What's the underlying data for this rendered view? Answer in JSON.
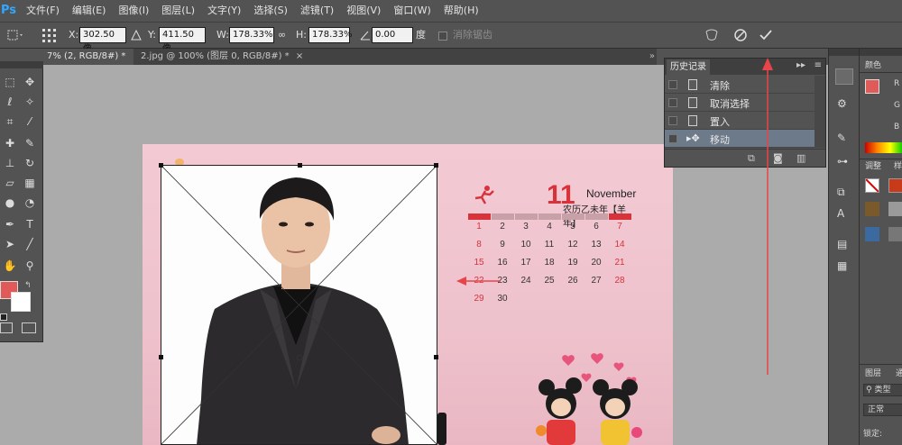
{
  "app": {
    "logo": "Ps",
    "menu": [
      "文件(F)",
      "编辑(E)",
      "图像(I)",
      "图层(L)",
      "文字(Y)",
      "选择(S)",
      "滤镜(T)",
      "视图(V)",
      "窗口(W)",
      "帮助(H)"
    ]
  },
  "options": {
    "x_label": "X:",
    "x_value": "302.50 像",
    "y_label": "Y:",
    "y_value": "411.50 像",
    "w_label": "W:",
    "w_value": "178.33%",
    "h_label": "H:",
    "h_value": "178.33%",
    "angle_value": "0.00",
    "angle_unit": "度",
    "antialias_label": "消除锯齿"
  },
  "tabs": [
    {
      "label": "7% (2, RGB/8#) *",
      "close": "×"
    },
    {
      "label": "2.jpg @ 100% (图层 0, RGB/8#) *",
      "close": "×"
    }
  ],
  "history": {
    "title": "历史记录",
    "items": [
      "清除",
      "取消选择",
      "置入",
      "移动"
    ],
    "active_index": 3
  },
  "right_panels": {
    "color_tab": "颜色",
    "color_r": "R",
    "color_g": "G",
    "color_b": "B",
    "adjust_tab": "调整",
    "style_tab": "样",
    "layers_tab": "图层",
    "channels_tab": "通",
    "layer_filter": "类型",
    "blend_mode": "正常",
    "lock_label": "锁定:"
  },
  "calendar": {
    "day": "11",
    "month_en": "November",
    "lunar": "农历乙未年【羊年】",
    "weeks": [
      [
        "",
        "1",
        "2",
        "3",
        "4",
        "5",
        "6",
        "7"
      ],
      [
        "",
        "8",
        "9",
        "10",
        "11",
        "12",
        "13",
        "14"
      ],
      [
        "",
        "15",
        "16",
        "17",
        "18",
        "19",
        "20",
        "21"
      ],
      [
        "",
        "22",
        "23",
        "24",
        "25",
        "26",
        "27",
        "28"
      ],
      [
        "",
        "29",
        "30",
        "",
        "",
        "",
        "",
        ""
      ]
    ]
  },
  "colors": {
    "foreground": "#e05a5a",
    "background": "#ffffff",
    "accent_red": "#d8323a",
    "annotation": "#e8454a"
  }
}
